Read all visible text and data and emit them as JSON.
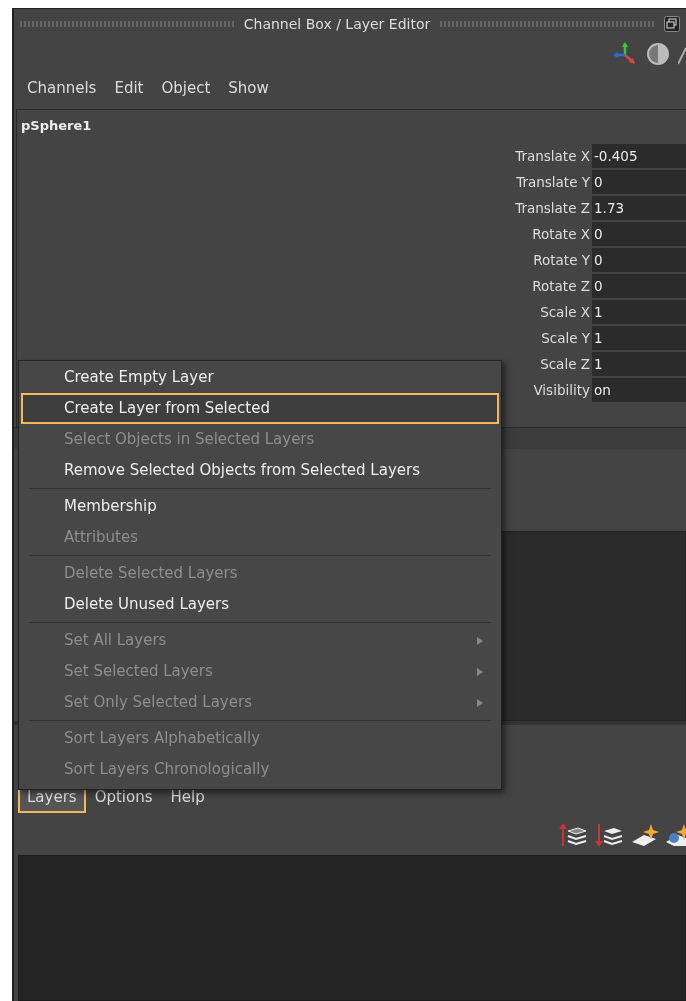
{
  "window": {
    "title": "Channel Box / Layer Editor"
  },
  "channel_menu": [
    "Channels",
    "Edit",
    "Object",
    "Show"
  ],
  "channel_box": {
    "object": "pSphere1",
    "attributes": [
      {
        "label": "Translate X",
        "value": "-0.405"
      },
      {
        "label": "Translate Y",
        "value": "0"
      },
      {
        "label": "Translate Z",
        "value": "1.73"
      },
      {
        "label": "Rotate X",
        "value": "0"
      },
      {
        "label": "Rotate Y",
        "value": "0"
      },
      {
        "label": "Rotate Z",
        "value": "0"
      },
      {
        "label": "Scale X",
        "value": "1"
      },
      {
        "label": "Scale Y",
        "value": "1"
      },
      {
        "label": "Scale Z",
        "value": "1"
      },
      {
        "label": "Visibility",
        "value": "on"
      }
    ]
  },
  "layer_menu": [
    {
      "label": "Layers",
      "selected": true
    },
    {
      "label": "Options",
      "selected": false
    },
    {
      "label": "Help",
      "selected": false
    }
  ],
  "popup_menu": [
    {
      "kind": "item",
      "label": "Create Empty Layer",
      "disabled": false,
      "highlighted": false,
      "submenu": false
    },
    {
      "kind": "item",
      "label": "Create Layer from Selected",
      "disabled": false,
      "highlighted": true,
      "submenu": false
    },
    {
      "kind": "item",
      "label": "Select Objects in Selected Layers",
      "disabled": true,
      "highlighted": false,
      "submenu": false
    },
    {
      "kind": "item",
      "label": "Remove Selected Objects from Selected Layers",
      "disabled": false,
      "highlighted": false,
      "submenu": false
    },
    {
      "kind": "separator"
    },
    {
      "kind": "item",
      "label": "Membership",
      "disabled": false,
      "highlighted": false,
      "submenu": false
    },
    {
      "kind": "item",
      "label": "Attributes",
      "disabled": true,
      "highlighted": false,
      "submenu": false
    },
    {
      "kind": "separator"
    },
    {
      "kind": "item",
      "label": "Delete Selected Layers",
      "disabled": true,
      "highlighted": false,
      "submenu": false
    },
    {
      "kind": "item",
      "label": "Delete Unused Layers",
      "disabled": false,
      "highlighted": false,
      "submenu": false
    },
    {
      "kind": "separator"
    },
    {
      "kind": "item",
      "label": "Set All Layers",
      "disabled": true,
      "highlighted": false,
      "submenu": true
    },
    {
      "kind": "item",
      "label": "Set Selected Layers",
      "disabled": true,
      "highlighted": false,
      "submenu": true
    },
    {
      "kind": "item",
      "label": "Set Only Selected Layers",
      "disabled": true,
      "highlighted": false,
      "submenu": true
    },
    {
      "kind": "separator"
    },
    {
      "kind": "item",
      "label": "Sort Layers Alphabetically",
      "disabled": true,
      "highlighted": false,
      "submenu": false
    },
    {
      "kind": "item",
      "label": "Sort Layers Chronologically",
      "disabled": true,
      "highlighted": false,
      "submenu": false
    }
  ]
}
